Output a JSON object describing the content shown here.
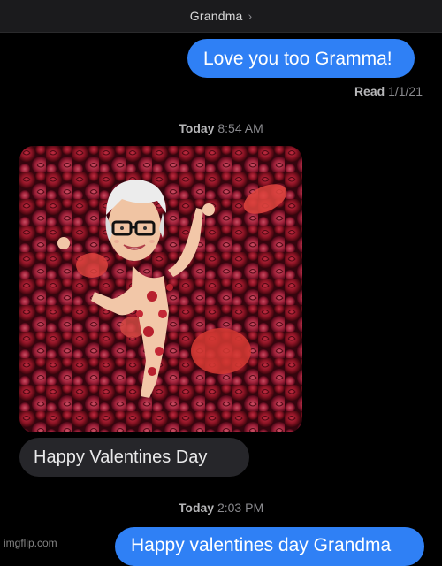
{
  "header": {
    "contact_name": "Grandma",
    "chevron_icon": "chevron-right-icon"
  },
  "messages": [
    {
      "direction": "outgoing",
      "text": "Love you too Gramma!"
    },
    {
      "direction": "incoming",
      "image": "bitmoji-valentine-rose-petals",
      "text": "Happy Valentines Day"
    },
    {
      "direction": "outgoing",
      "text": "Happy valentines day Grandma"
    }
  ],
  "read_receipt": {
    "label": "Read",
    "date": "1/1/21"
  },
  "timestamps": [
    {
      "day": "Today",
      "time": "8:54 AM"
    },
    {
      "day": "Today",
      "time": "2:03 PM"
    }
  ],
  "colors": {
    "outgoing_bubble": "#2f80f5",
    "incoming_bubble": "#26262a",
    "background": "#000000"
  },
  "watermark": "imgflip.com"
}
